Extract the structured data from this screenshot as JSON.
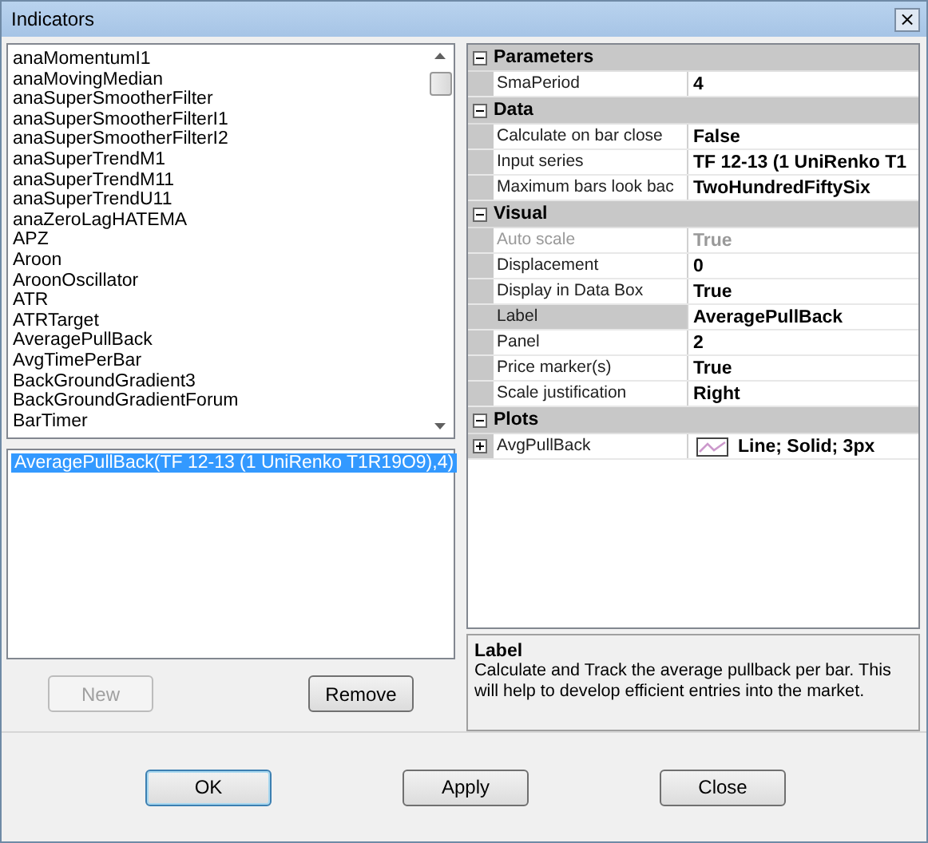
{
  "window": {
    "title": "Indicators",
    "close": "×"
  },
  "indicator_list": {
    "items": [
      {
        "label": "anaMomentumI1",
        "selected": false
      },
      {
        "label": "anaMovingMedian",
        "selected": false
      },
      {
        "label": "anaSuperSmootherFilter",
        "selected": false
      },
      {
        "label": "anaSuperSmootherFilterI1",
        "selected": false
      },
      {
        "label": "anaSuperSmootherFilterI2",
        "selected": false
      },
      {
        "label": "anaSuperTrendM1",
        "selected": false
      },
      {
        "label": "anaSuperTrendM11",
        "selected": false
      },
      {
        "label": "anaSuperTrendU11",
        "selected": false
      },
      {
        "label": "anaZeroLagHATEMA",
        "selected": false
      },
      {
        "label": "APZ",
        "selected": false
      },
      {
        "label": "Aroon",
        "selected": false
      },
      {
        "label": "AroonOscillator",
        "selected": false
      },
      {
        "label": "ATR",
        "selected": false
      },
      {
        "label": "ATRTarget",
        "selected": false
      },
      {
        "label": "AveragePullBack",
        "selected": false
      },
      {
        "label": "AvgTimePerBar",
        "selected": false
      },
      {
        "label": "BackGroundGradient3",
        "selected": false
      },
      {
        "label": "BackGroundGradientForum",
        "selected": false
      },
      {
        "label": "BarTimer",
        "selected": false
      }
    ]
  },
  "applied_list": {
    "items": [
      {
        "label": "AveragePullBack(TF 12-13 (1 UniRenko T1R19O9),4)",
        "selected": true
      }
    ]
  },
  "list_buttons": [
    {
      "label": "New",
      "disabled": true
    },
    {
      "label": "Remove",
      "disabled": false
    }
  ],
  "property_grid": {
    "categories": [
      {
        "name": "Parameters",
        "expanded": true,
        "properties": [
          {
            "name": "SmaPeriod",
            "value": "4",
            "disabled": false,
            "selected": false
          }
        ]
      },
      {
        "name": "Data",
        "expanded": true,
        "properties": [
          {
            "name": "Calculate on bar close",
            "value": "False",
            "disabled": false,
            "selected": false
          },
          {
            "name": "Input series",
            "value": "TF 12-13 (1 UniRenko T1",
            "disabled": false,
            "selected": false
          },
          {
            "name": "Maximum bars look bac",
            "value": "TwoHundredFiftySix",
            "disabled": false,
            "selected": false
          }
        ]
      },
      {
        "name": "Visual",
        "expanded": true,
        "properties": [
          {
            "name": "Auto scale",
            "value": "True",
            "disabled": true,
            "selected": false
          },
          {
            "name": "Displacement",
            "value": "0",
            "disabled": false,
            "selected": false
          },
          {
            "name": "Display in Data Box",
            "value": "True",
            "disabled": false,
            "selected": false
          },
          {
            "name": "Label",
            "value": "AveragePullBack",
            "disabled": false,
            "selected": true
          },
          {
            "name": "Panel",
            "value": "2",
            "disabled": false,
            "selected": false
          },
          {
            "name": "Price marker(s)",
            "value": "True",
            "disabled": false,
            "selected": false
          },
          {
            "name": "Scale justification",
            "value": "Right",
            "disabled": false,
            "selected": false
          }
        ]
      },
      {
        "name": "Plots",
        "expanded": true,
        "properties": [
          {
            "name": "AvgPullBack",
            "value": "Line; Solid; 3px",
            "disabled": false,
            "selected": false,
            "expanded": false,
            "kind": "plot"
          }
        ]
      }
    ]
  },
  "description": {
    "title": "Label",
    "text": "Calculate and Track the average pullback per bar. This will help to develop efficient entries into the market."
  },
  "dialog_buttons": [
    {
      "label": "OK",
      "default": true
    },
    {
      "label": "Apply",
      "default": false
    },
    {
      "label": "Close",
      "default": false
    }
  ]
}
